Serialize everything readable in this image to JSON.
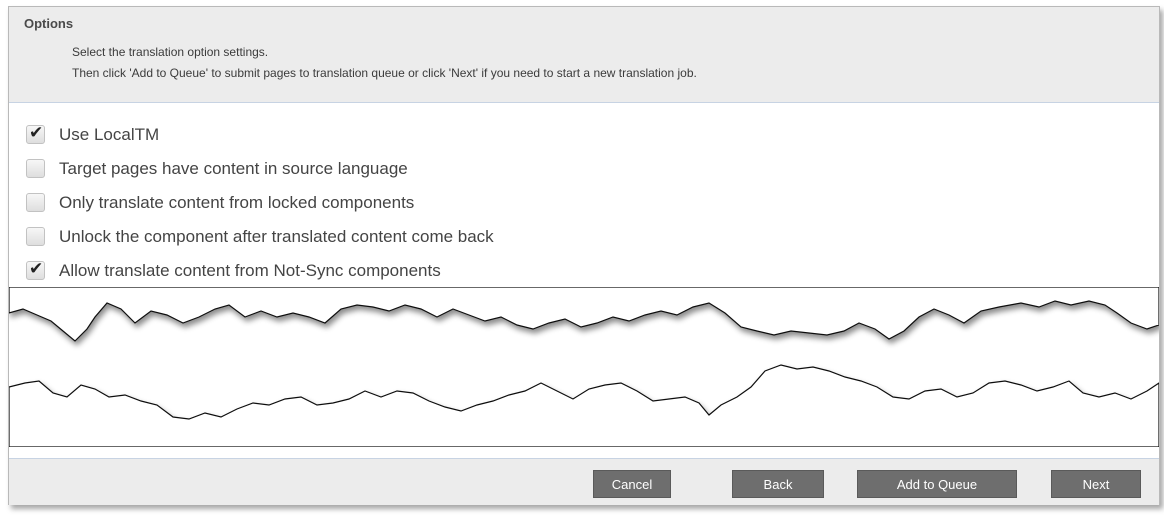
{
  "header": {
    "title": "Options",
    "line1": "Select the translation option settings.",
    "line2": "Then click 'Add to Queue' to submit pages to translation queue or click 'Next' if you need to start a new translation job."
  },
  "options": [
    {
      "label": "Use LocalTM",
      "checked": true
    },
    {
      "label": "Target pages have content in source language",
      "checked": false
    },
    {
      "label": "Only translate content from locked components",
      "checked": false
    },
    {
      "label": "Unlock the component after translated content come back",
      "checked": false
    },
    {
      "label": "Allow translate content from Not-Sync components",
      "checked": true
    }
  ],
  "footer": {
    "cancel": "Cancel",
    "back": "Back",
    "add_to_queue": "Add to Queue",
    "next": "Next"
  },
  "colors": {
    "button_bg": "#6e6e6e",
    "header_bg": "#ececec"
  }
}
